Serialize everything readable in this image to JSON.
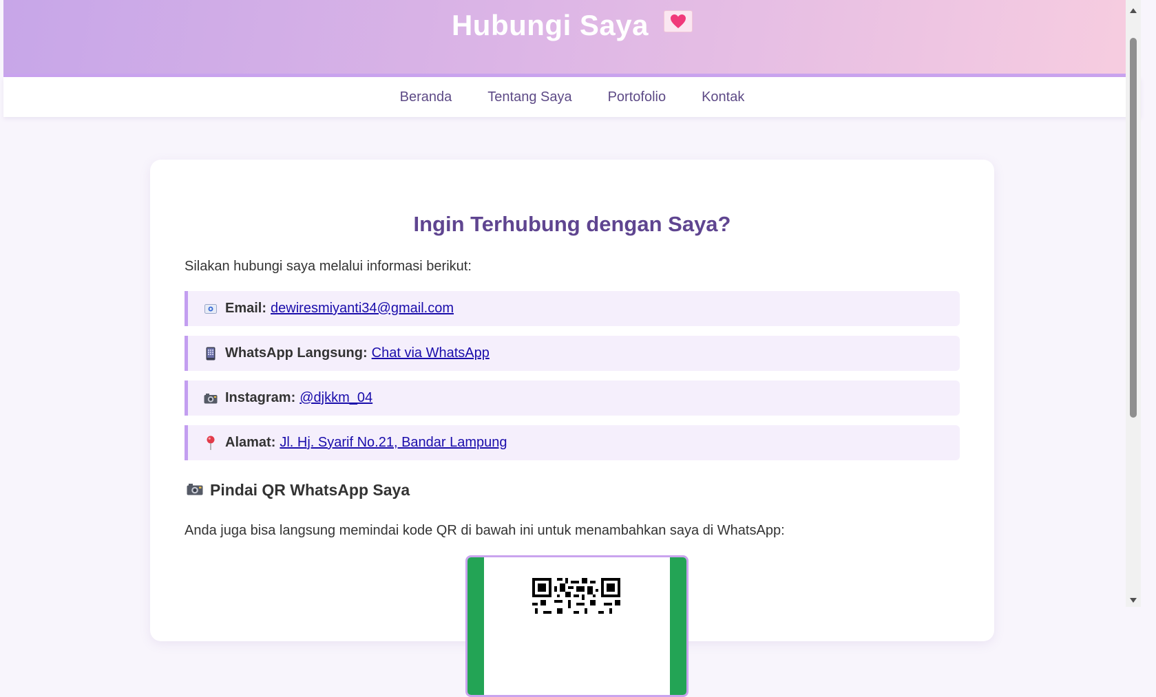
{
  "header": {
    "title": "Hubungi Saya",
    "emoji": "heart-letter-icon"
  },
  "nav": {
    "items": [
      "Beranda",
      "Tentang Saya",
      "Portofolio",
      "Kontak"
    ]
  },
  "main": {
    "heading": "Ingin Terhubung dengan Saya?",
    "intro": "Silakan hubungi saya melalui informasi berikut:",
    "contacts": [
      {
        "icon": "email-icon",
        "label": "Email:",
        "value": "dewiresmiyanti34@gmail.com"
      },
      {
        "icon": "phone-icon",
        "label": "WhatsApp Langsung:",
        "value": "Chat via WhatsApp"
      },
      {
        "icon": "camera-icon",
        "label": "Instagram:",
        "value": "@djkkm_04"
      },
      {
        "icon": "pin-icon",
        "label": "Alamat:",
        "value": "Jl. Hj. Syarif No.21, Bandar Lampung"
      }
    ],
    "qr_heading": "Pindai QR WhatsApp Saya",
    "qr_text": "Anda juga bisa langsung memindai kode QR di bawah ini untuk menambahkan saya di WhatsApp:"
  },
  "colors": {
    "accent": "#c39ef0",
    "heading": "#5f4590",
    "nav_text": "#5d4a86",
    "link": "#1a0dab",
    "whatsapp": "#23a455"
  }
}
